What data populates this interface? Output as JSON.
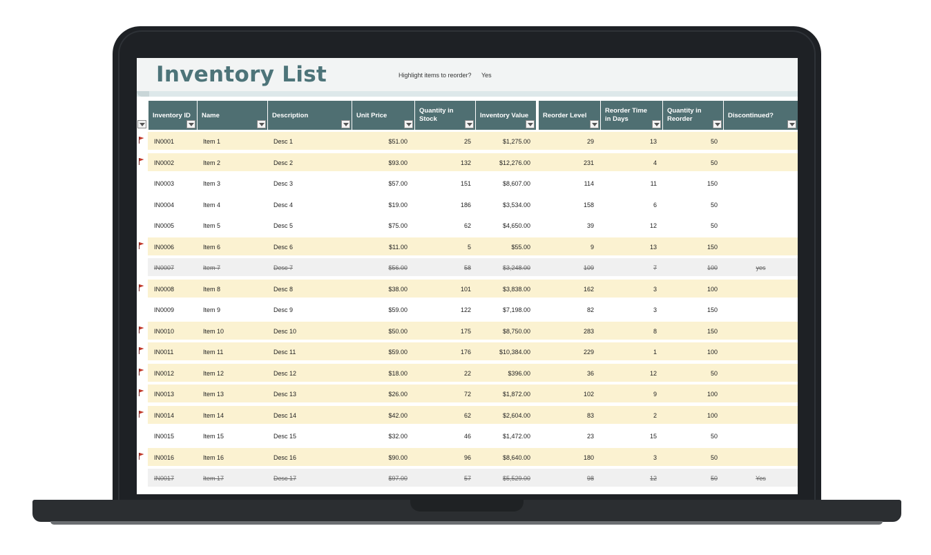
{
  "sheet": {
    "title": "Inventory List",
    "highlight_label": "Highlight items to reorder?",
    "highlight_value": "Yes"
  },
  "headers": [
    "Inventory ID",
    "Name",
    "Description",
    "Unit Price",
    "Quantity in Stock",
    "Inventory Value",
    "Reorder Level",
    "Reorder Time in Days",
    "Quantity in Reorder",
    "Discontinued?"
  ],
  "rows": [
    {
      "id": "IN0001",
      "name": "Item 1",
      "desc": "Desc 1",
      "price": "$51.00",
      "qty": "25",
      "value": "$1,275.00",
      "reorder_level": "29",
      "reorder_days": "13",
      "reorder_qty": "50",
      "discontinued": "",
      "flagged": true
    },
    {
      "id": "IN0002",
      "name": "Item 2",
      "desc": "Desc 2",
      "price": "$93.00",
      "qty": "132",
      "value": "$12,276.00",
      "reorder_level": "231",
      "reorder_days": "4",
      "reorder_qty": "50",
      "discontinued": "",
      "flagged": true
    },
    {
      "id": "IN0003",
      "name": "Item 3",
      "desc": "Desc 3",
      "price": "$57.00",
      "qty": "151",
      "value": "$8,607.00",
      "reorder_level": "114",
      "reorder_days": "11",
      "reorder_qty": "150",
      "discontinued": "",
      "flagged": false
    },
    {
      "id": "IN0004",
      "name": "Item 4",
      "desc": "Desc 4",
      "price": "$19.00",
      "qty": "186",
      "value": "$3,534.00",
      "reorder_level": "158",
      "reorder_days": "6",
      "reorder_qty": "50",
      "discontinued": "",
      "flagged": false
    },
    {
      "id": "IN0005",
      "name": "Item 5",
      "desc": "Desc 5",
      "price": "$75.00",
      "qty": "62",
      "value": "$4,650.00",
      "reorder_level": "39",
      "reorder_days": "12",
      "reorder_qty": "50",
      "discontinued": "",
      "flagged": false
    },
    {
      "id": "IN0006",
      "name": "Item 6",
      "desc": "Desc 6",
      "price": "$11.00",
      "qty": "5",
      "value": "$55.00",
      "reorder_level": "9",
      "reorder_days": "13",
      "reorder_qty": "150",
      "discontinued": "",
      "flagged": true
    },
    {
      "id": "IN0007",
      "name": "Item 7",
      "desc": "Desc 7",
      "price": "$56.00",
      "qty": "58",
      "value": "$3,248.00",
      "reorder_level": "109",
      "reorder_days": "7",
      "reorder_qty": "100",
      "discontinued": "yes",
      "flagged": false
    },
    {
      "id": "IN0008",
      "name": "Item 8",
      "desc": "Desc 8",
      "price": "$38.00",
      "qty": "101",
      "value": "$3,838.00",
      "reorder_level": "162",
      "reorder_days": "3",
      "reorder_qty": "100",
      "discontinued": "",
      "flagged": true
    },
    {
      "id": "IN0009",
      "name": "Item 9",
      "desc": "Desc 9",
      "price": "$59.00",
      "qty": "122",
      "value": "$7,198.00",
      "reorder_level": "82",
      "reorder_days": "3",
      "reorder_qty": "150",
      "discontinued": "",
      "flagged": false
    },
    {
      "id": "IN0010",
      "name": "Item 10",
      "desc": "Desc 10",
      "price": "$50.00",
      "qty": "175",
      "value": "$8,750.00",
      "reorder_level": "283",
      "reorder_days": "8",
      "reorder_qty": "150",
      "discontinued": "",
      "flagged": true
    },
    {
      "id": "IN0011",
      "name": "Item 11",
      "desc": "Desc 11",
      "price": "$59.00",
      "qty": "176",
      "value": "$10,384.00",
      "reorder_level": "229",
      "reorder_days": "1",
      "reorder_qty": "100",
      "discontinued": "",
      "flagged": true
    },
    {
      "id": "IN0012",
      "name": "Item 12",
      "desc": "Desc 12",
      "price": "$18.00",
      "qty": "22",
      "value": "$396.00",
      "reorder_level": "36",
      "reorder_days": "12",
      "reorder_qty": "50",
      "discontinued": "",
      "flagged": true
    },
    {
      "id": "IN0013",
      "name": "Item 13",
      "desc": "Desc 13",
      "price": "$26.00",
      "qty": "72",
      "value": "$1,872.00",
      "reorder_level": "102",
      "reorder_days": "9",
      "reorder_qty": "100",
      "discontinued": "",
      "flagged": true
    },
    {
      "id": "IN0014",
      "name": "Item 14",
      "desc": "Desc 14",
      "price": "$42.00",
      "qty": "62",
      "value": "$2,604.00",
      "reorder_level": "83",
      "reorder_days": "2",
      "reorder_qty": "100",
      "discontinued": "",
      "flagged": true
    },
    {
      "id": "IN0015",
      "name": "Item 15",
      "desc": "Desc 15",
      "price": "$32.00",
      "qty": "46",
      "value": "$1,472.00",
      "reorder_level": "23",
      "reorder_days": "15",
      "reorder_qty": "50",
      "discontinued": "",
      "flagged": false
    },
    {
      "id": "IN0016",
      "name": "Item 16",
      "desc": "Desc 16",
      "price": "$90.00",
      "qty": "96",
      "value": "$8,640.00",
      "reorder_level": "180",
      "reorder_days": "3",
      "reorder_qty": "50",
      "discontinued": "",
      "flagged": true
    },
    {
      "id": "IN0017",
      "name": "Item 17",
      "desc": "Desc 17",
      "price": "$97.00",
      "qty": "57",
      "value": "$5,529.00",
      "reorder_level": "98",
      "reorder_days": "12",
      "reorder_qty": "50",
      "discontinued": "Yes",
      "flagged": false
    }
  ],
  "colors": {
    "header_bg": "#4f6f72",
    "title_color": "#4d7479",
    "flag_row_bg": "#fbf2d1",
    "flag_color": "#c0392b"
  },
  "icons": {
    "flag": "flag-icon",
    "filter": "filter-dropdown-icon"
  }
}
